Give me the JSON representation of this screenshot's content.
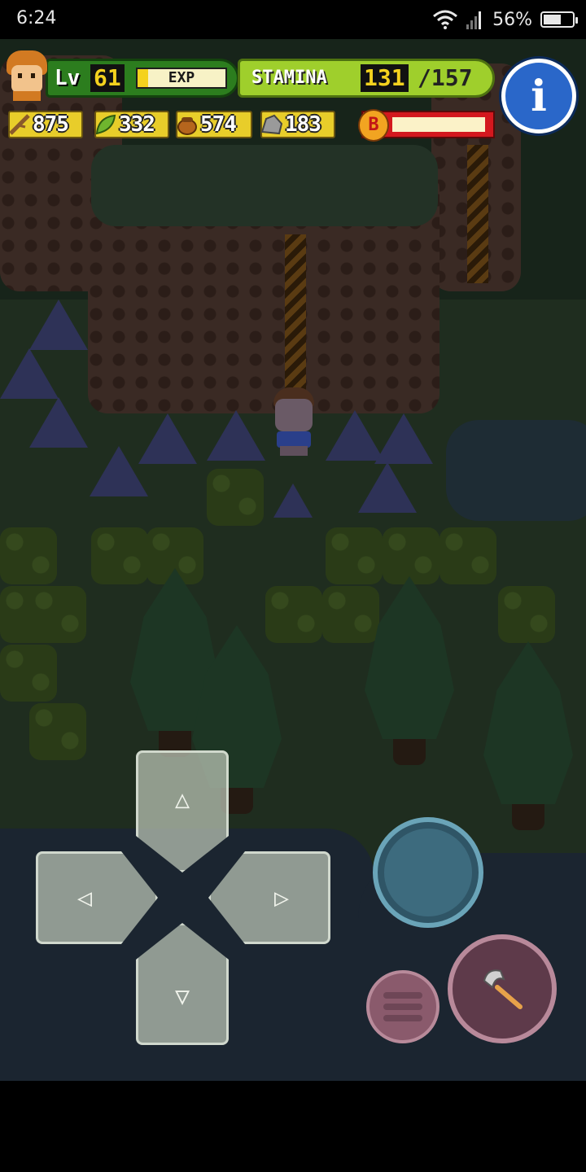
{
  "status_bar": {
    "time": "6:24",
    "battery_percent": "56%",
    "icons": [
      "wifi-icon",
      "signal-icon",
      "battery-icon"
    ]
  },
  "hud": {
    "level_label": "Lv",
    "level": "61",
    "exp_label": "EXP",
    "exp_fill": 0.12,
    "stamina_label": "STAMINA",
    "stamina_current": "131",
    "stamina_max": "/157",
    "resources": [
      {
        "icon": "wood-stick-icon",
        "value": "875"
      },
      {
        "icon": "leaf-icon",
        "value": "332"
      },
      {
        "icon": "nut-icon",
        "value": "574"
      },
      {
        "icon": "stone-icon",
        "value": "183"
      }
    ],
    "boss_bar_icon_letter": "B",
    "boss_bar_fill": 0.95,
    "info_button_icon": "i"
  },
  "controls": {
    "dpad": {
      "up": "△",
      "down": "▽",
      "left": "◁",
      "right": "▷"
    },
    "tool_icon": "axe-icon",
    "action_button": "action-button",
    "menu_button": "menu-button"
  },
  "colors": {
    "level_bar": "#2c7d1e",
    "stamina_bar": "#9fcf2c",
    "resource_bg": "#e8cd2a",
    "boss_bar": "#d3181e",
    "info_button": "#2a67c9",
    "action_button": "#3d6b7e",
    "tool_button": "#5e3a4a"
  }
}
